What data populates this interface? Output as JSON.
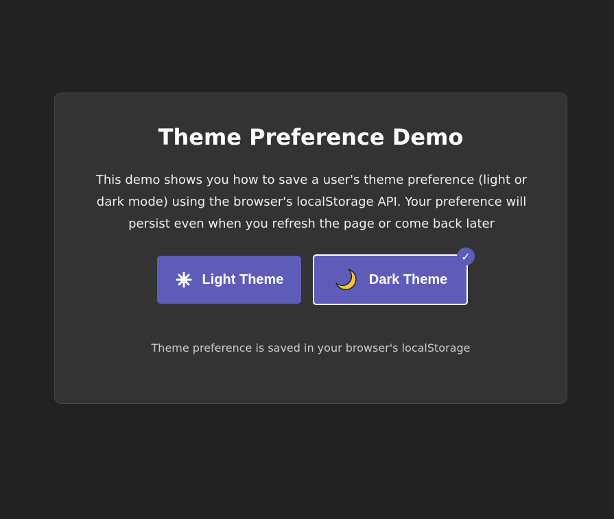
{
  "page": {
    "title": "Theme Preference Demo",
    "description": "This demo shows you how to save a user's theme preference (light or dark mode) using the browser's localStorage API. Your preference will persist even when you refresh the page or come back later",
    "note": "Theme preference is saved in your browser's localStorage"
  },
  "buttons": {
    "light": {
      "label": "Light Theme",
      "icon": "sun-icon"
    },
    "dark": {
      "label": "Dark Theme",
      "icon": "moon-icon",
      "selected": true,
      "check": "✓"
    }
  },
  "colors": {
    "background": "#222222",
    "card": "#333333",
    "accent": "#5e5cb8",
    "moon": "#f5c242"
  }
}
